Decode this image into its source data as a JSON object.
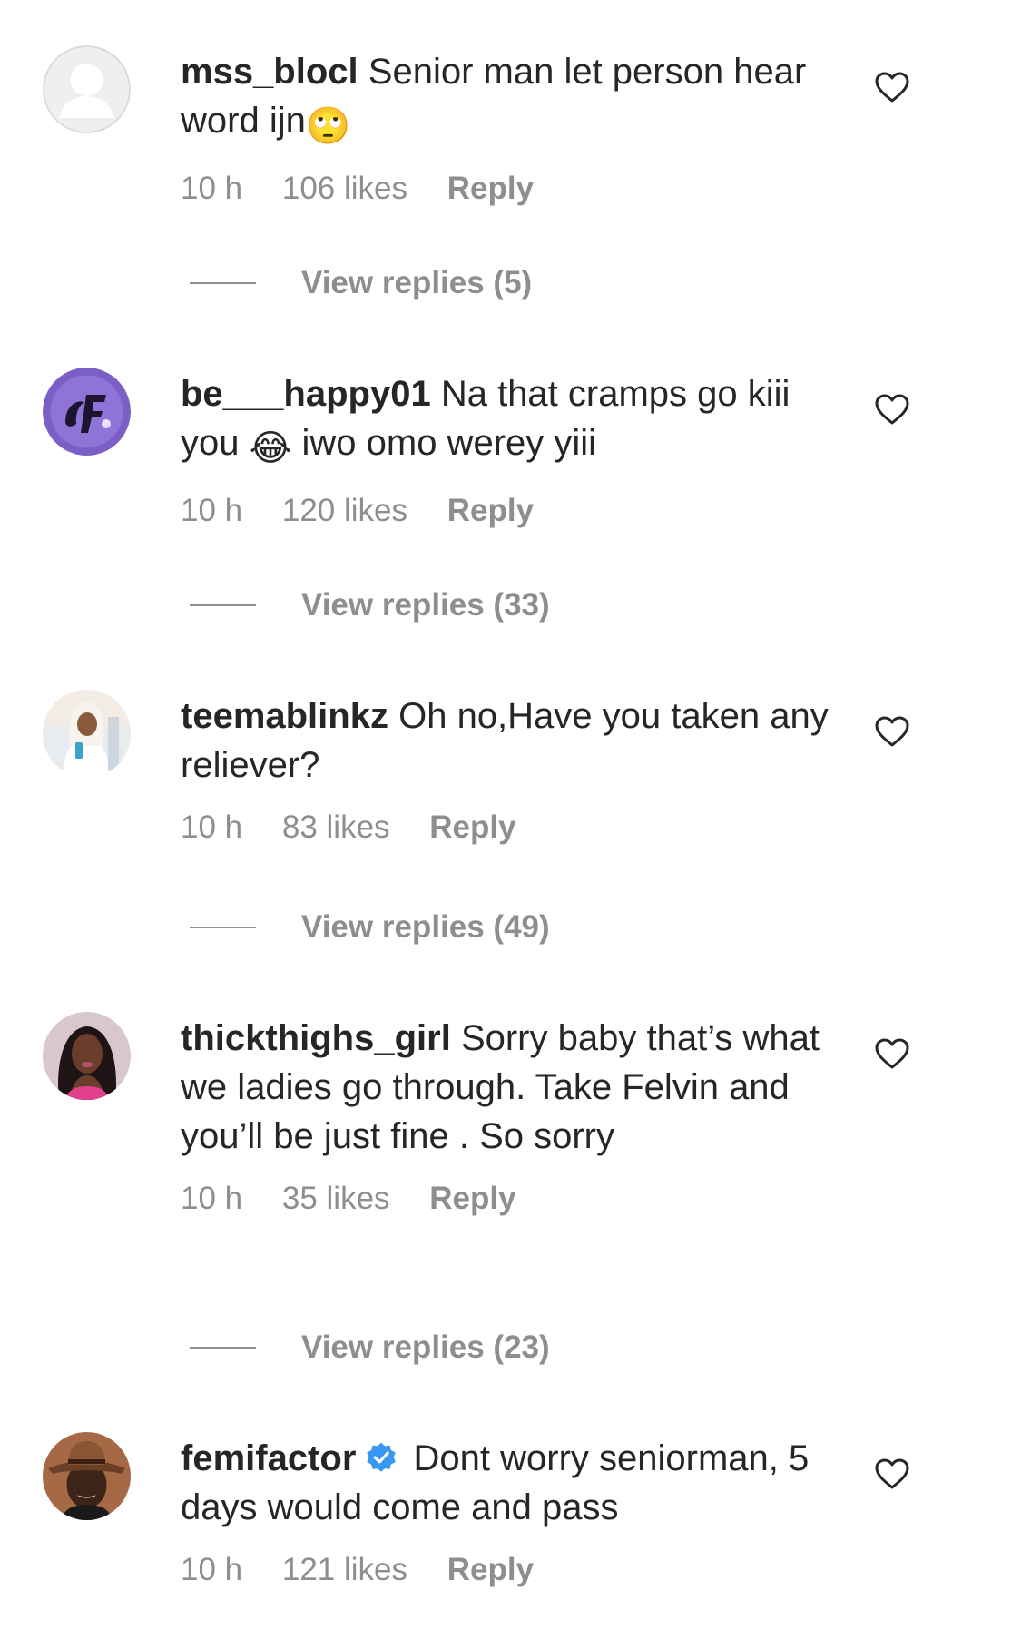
{
  "comments": [
    {
      "username": "mss_blocl",
      "text": "Senior man let person hear word ijn",
      "emoji": "🙄",
      "time": "10 h",
      "likes": "106 likes",
      "reply_label": "Reply",
      "view_replies": "View replies (5)",
      "avatar": "default-avatar-icon"
    },
    {
      "username": "be___happy01",
      "text_before": "Na that cramps go kiii you",
      "emoji": "😂",
      "text_after": "iwo omo werey yiii",
      "time": "10 h",
      "likes": "120 likes",
      "reply_label": "Reply",
      "view_replies": "View replies (33)",
      "avatar": "logo-avatar"
    },
    {
      "username": "teemablinkz",
      "text": "Oh no,Have you taken any reliever?",
      "time": "10 h",
      "likes": "83 likes",
      "reply_label": "Reply",
      "view_replies": "View replies (49)",
      "avatar": "photo-avatar"
    },
    {
      "username": "thickthighs_girl",
      "text": "Sorry baby that’s what we ladies go through. Take Felvin and you’ll be just fine . So sorry",
      "time": "10 h",
      "likes": "35 likes",
      "reply_label": "Reply",
      "view_replies": "View replies (23)",
      "avatar": "photo-avatar"
    },
    {
      "username": "femifactor",
      "verified": true,
      "text": "Dont worry seniorman, 5 days would come and pass",
      "time": "10 h",
      "likes": "121 likes",
      "reply_label": "Reply",
      "avatar": "photo-avatar"
    }
  ],
  "colors": {
    "text": "#262626",
    "secondary": "#8e8e8e",
    "verified": "#3897f0",
    "background": "#ffffff"
  },
  "icons": {
    "like": "heart-outline-icon",
    "verified": "verified-badge-icon"
  }
}
